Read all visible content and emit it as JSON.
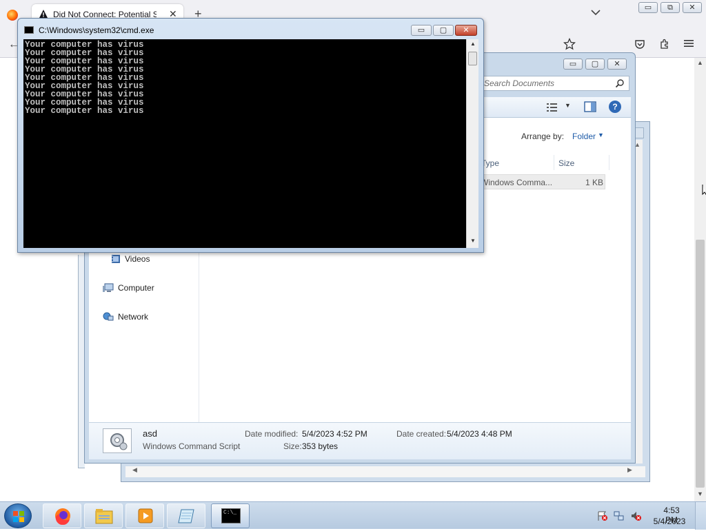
{
  "firefox": {
    "tab_title": "Did Not Connect: Potential Security Issue",
    "tab_close": "✕",
    "new_tab": "+",
    "back": "←",
    "min": "▭",
    "max": "⧉",
    "close": "✕"
  },
  "cmd": {
    "title": "C:\\Windows\\system32\\cmd.exe",
    "close": "✕",
    "lines": [
      "Your computer has virus",
      "Your computer has virus",
      "Your computer has virus",
      "Your computer has virus",
      "Your computer has virus",
      "Your computer has virus",
      "Your computer has virus",
      "Your computer has virus",
      "Your computer has virus"
    ]
  },
  "explorer": {
    "search_placeholder": "Search Documents",
    "arrange_label": "Arrange by:",
    "arrange_value": "Folder",
    "columns": {
      "type": "Type",
      "size": "Size"
    },
    "row": {
      "type": "Windows Comma...",
      "size": "1 KB"
    },
    "nav": {
      "videos": "Videos",
      "computer": "Computer",
      "network": "Network"
    },
    "details": {
      "name": "asd",
      "type": "Windows Command Script",
      "date_modified_label": "Date modified:",
      "date_modified": "5/4/2023 4:52 PM",
      "size_label": "Size:",
      "size": "353 bytes",
      "date_created_label": "Date created:",
      "date_created": "5/4/2023 4:48 PM"
    }
  },
  "taskbar": {
    "time": "4:53 PM",
    "date": "5/4/2023",
    "cmd_prompt": "C:\\_"
  },
  "colors": {
    "cmd_background": "#000000",
    "cmd_text": "#c0c0c0",
    "window_frame": "#c9d9ea",
    "link_blue": "#1e5ba8"
  }
}
